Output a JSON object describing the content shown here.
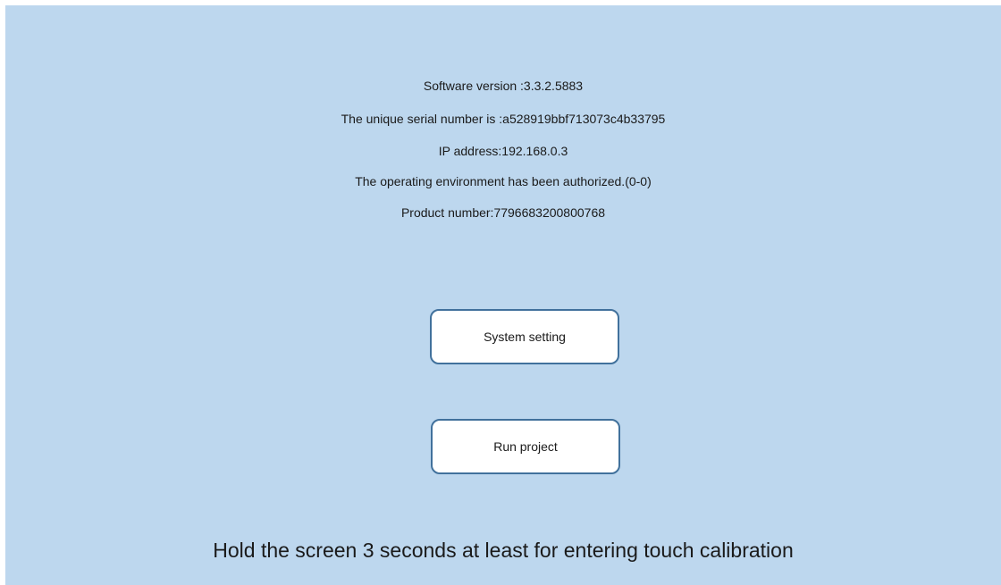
{
  "info": {
    "software_version": "Software version :3.3.2.5883",
    "serial_number": "The unique serial number is :a528919bbf713073c4b33795",
    "ip_address": "IP address:192.168.0.3",
    "authorization": "The operating environment has been authorized.(0-0)",
    "product_number": "Product number:7796683200800768"
  },
  "buttons": {
    "system_setting": "System setting",
    "run_project": "Run project"
  },
  "hint": "Hold the screen 3 seconds at least for entering touch calibration",
  "colors": {
    "background": "#bdd7ee",
    "button_border": "#41719c",
    "button_fill": "#ffffff"
  }
}
